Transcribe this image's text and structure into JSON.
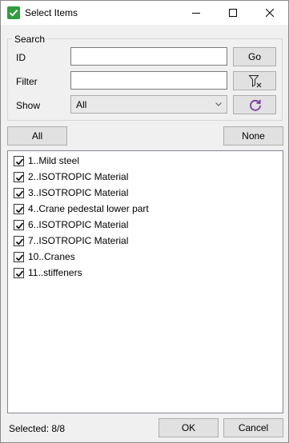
{
  "window": {
    "title": "Select Items"
  },
  "search": {
    "group_label": "Search",
    "id_label": "ID",
    "id_value": "",
    "go_label": "Go",
    "filter_label": "Filter",
    "filter_value": "",
    "show_label": "Show",
    "show_selected": "All"
  },
  "selection": {
    "all_label": "All",
    "none_label": "None"
  },
  "items": [
    {
      "label": "1..Mild steel",
      "checked": true
    },
    {
      "label": "2..ISOTROPIC Material",
      "checked": true
    },
    {
      "label": "3..ISOTROPIC Material",
      "checked": true
    },
    {
      "label": "4..Crane pedestal lower part",
      "checked": true
    },
    {
      "label": "6..ISOTROPIC Material",
      "checked": true
    },
    {
      "label": "7..ISOTROPIC Material",
      "checked": true
    },
    {
      "label": "10..Cranes",
      "checked": true
    },
    {
      "label": "11..stiffeners",
      "checked": true
    }
  ],
  "footer": {
    "status": "Selected: 8/8",
    "ok_label": "OK",
    "cancel_label": "Cancel"
  },
  "colors": {
    "app_icon": "#2e9e3e",
    "refresh_icon": "#7a3ea0"
  }
}
